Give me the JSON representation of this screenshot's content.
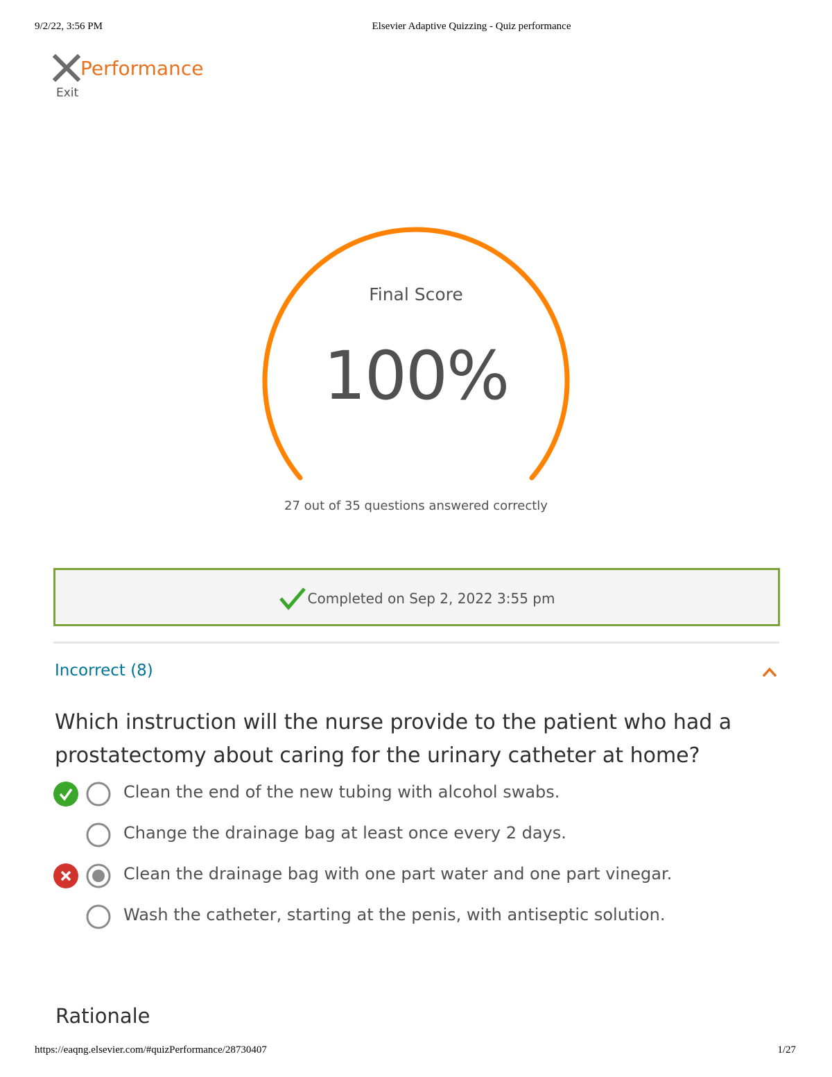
{
  "print_header": {
    "datetime": "9/2/22, 3:56 PM",
    "doc_title": "Elsevier Adaptive Quizzing - Quiz performance"
  },
  "topbar": {
    "exit_label": "Exit",
    "title": "Performance",
    "accent_color": "#e9711c"
  },
  "score": {
    "label": "Final Score",
    "value": "100%",
    "fill_fraction": 1.0,
    "summary": "27 out of 35 questions answered correctly"
  },
  "completion": {
    "text": "Completed on Sep 2, 2022 3:55 pm",
    "border_color": "#7aa33a",
    "check_color": "#3aa62a"
  },
  "section": {
    "label": "Incorrect (8)",
    "color": "#007398",
    "expanded": true
  },
  "question": {
    "text": "Which instruction will the nurse provide to the patient who had a prostatectomy about caring for the urinary catheter at home?",
    "answers": [
      {
        "text": "Clean the end of the new tubing with alcohol swabs.",
        "status": "correct",
        "selected": false
      },
      {
        "text": "Change the drainage bag at least once every 2 days.",
        "status": "none",
        "selected": false
      },
      {
        "text": "Clean the drainage bag with one part water and one part vinegar.",
        "status": "incorrect",
        "selected": true
      },
      {
        "text": "Wash the catheter, starting at the penis, with antiseptic solution.",
        "status": "none",
        "selected": false
      }
    ]
  },
  "rationale": {
    "heading": "Rationale"
  },
  "print_footer": {
    "url": "https://eaqng.elsevier.com/#quizPerformance/28730407",
    "page": "1/27"
  },
  "icons": {
    "exit": "close-x-icon",
    "completed": "check-icon",
    "collapse": "chevron-up-icon",
    "correct": "correct-check-icon",
    "incorrect": "incorrect-x-icon"
  }
}
